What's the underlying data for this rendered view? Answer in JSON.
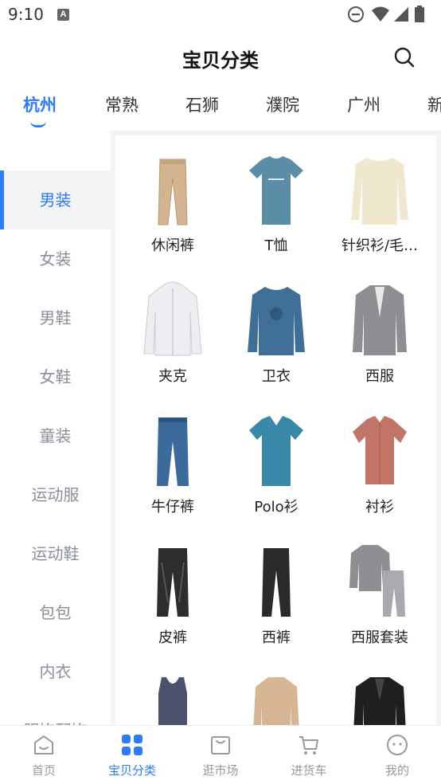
{
  "status_bar": {
    "time": "9:10",
    "app_icon_letter": "A"
  },
  "header": {
    "title": "宝贝分类"
  },
  "city_tabs": [
    {
      "label": "杭州",
      "active": true
    },
    {
      "label": "常熟",
      "active": false
    },
    {
      "label": "石狮",
      "active": false
    },
    {
      "label": "濮院",
      "active": false
    },
    {
      "label": "广州",
      "active": false
    },
    {
      "label": "新",
      "active": false
    }
  ],
  "sidebar": {
    "items": [
      {
        "label": "男装",
        "active": true
      },
      {
        "label": "女装"
      },
      {
        "label": "男鞋"
      },
      {
        "label": "女鞋"
      },
      {
        "label": "童装"
      },
      {
        "label": "运动服"
      },
      {
        "label": "运动鞋"
      },
      {
        "label": "包包"
      },
      {
        "label": "内衣"
      },
      {
        "label": "服饰配饰"
      }
    ]
  },
  "categories": [
    {
      "label": "休闲裤",
      "icon": "chino-pants-icon"
    },
    {
      "label": "T恤",
      "icon": "tshirt-icon"
    },
    {
      "label": "针织衫/毛…",
      "icon": "sweater-icon"
    },
    {
      "label": "夹克",
      "icon": "jacket-icon"
    },
    {
      "label": "卫衣",
      "icon": "sweatshirt-icon"
    },
    {
      "label": "西服",
      "icon": "blazer-icon"
    },
    {
      "label": "牛仔裤",
      "icon": "jeans-icon"
    },
    {
      "label": "Polo衫",
      "icon": "polo-shirt-icon"
    },
    {
      "label": "衬衫",
      "icon": "shirt-icon"
    },
    {
      "label": "皮裤",
      "icon": "leather-pants-icon"
    },
    {
      "label": "西裤",
      "icon": "dress-pants-icon"
    },
    {
      "label": "西服套装",
      "icon": "suit-icon"
    },
    {
      "label": "",
      "icon": "tank-top-icon"
    },
    {
      "label": "",
      "icon": "trench-coat-icon"
    },
    {
      "label": "",
      "icon": "leather-jacket-icon"
    }
  ],
  "bottom_nav": [
    {
      "label": "首页",
      "icon": "home-icon",
      "active": false
    },
    {
      "label": "宝贝分类",
      "icon": "category-grid-icon",
      "active": true
    },
    {
      "label": "逛市场",
      "icon": "market-bag-icon",
      "active": false
    },
    {
      "label": "进货车",
      "icon": "cart-icon",
      "active": false
    },
    {
      "label": "我的",
      "icon": "profile-icon",
      "active": false
    }
  ],
  "colors": {
    "accent": "#2e7bf6",
    "inactive_text": "#8a8f99",
    "background": "#f4f4f4"
  }
}
